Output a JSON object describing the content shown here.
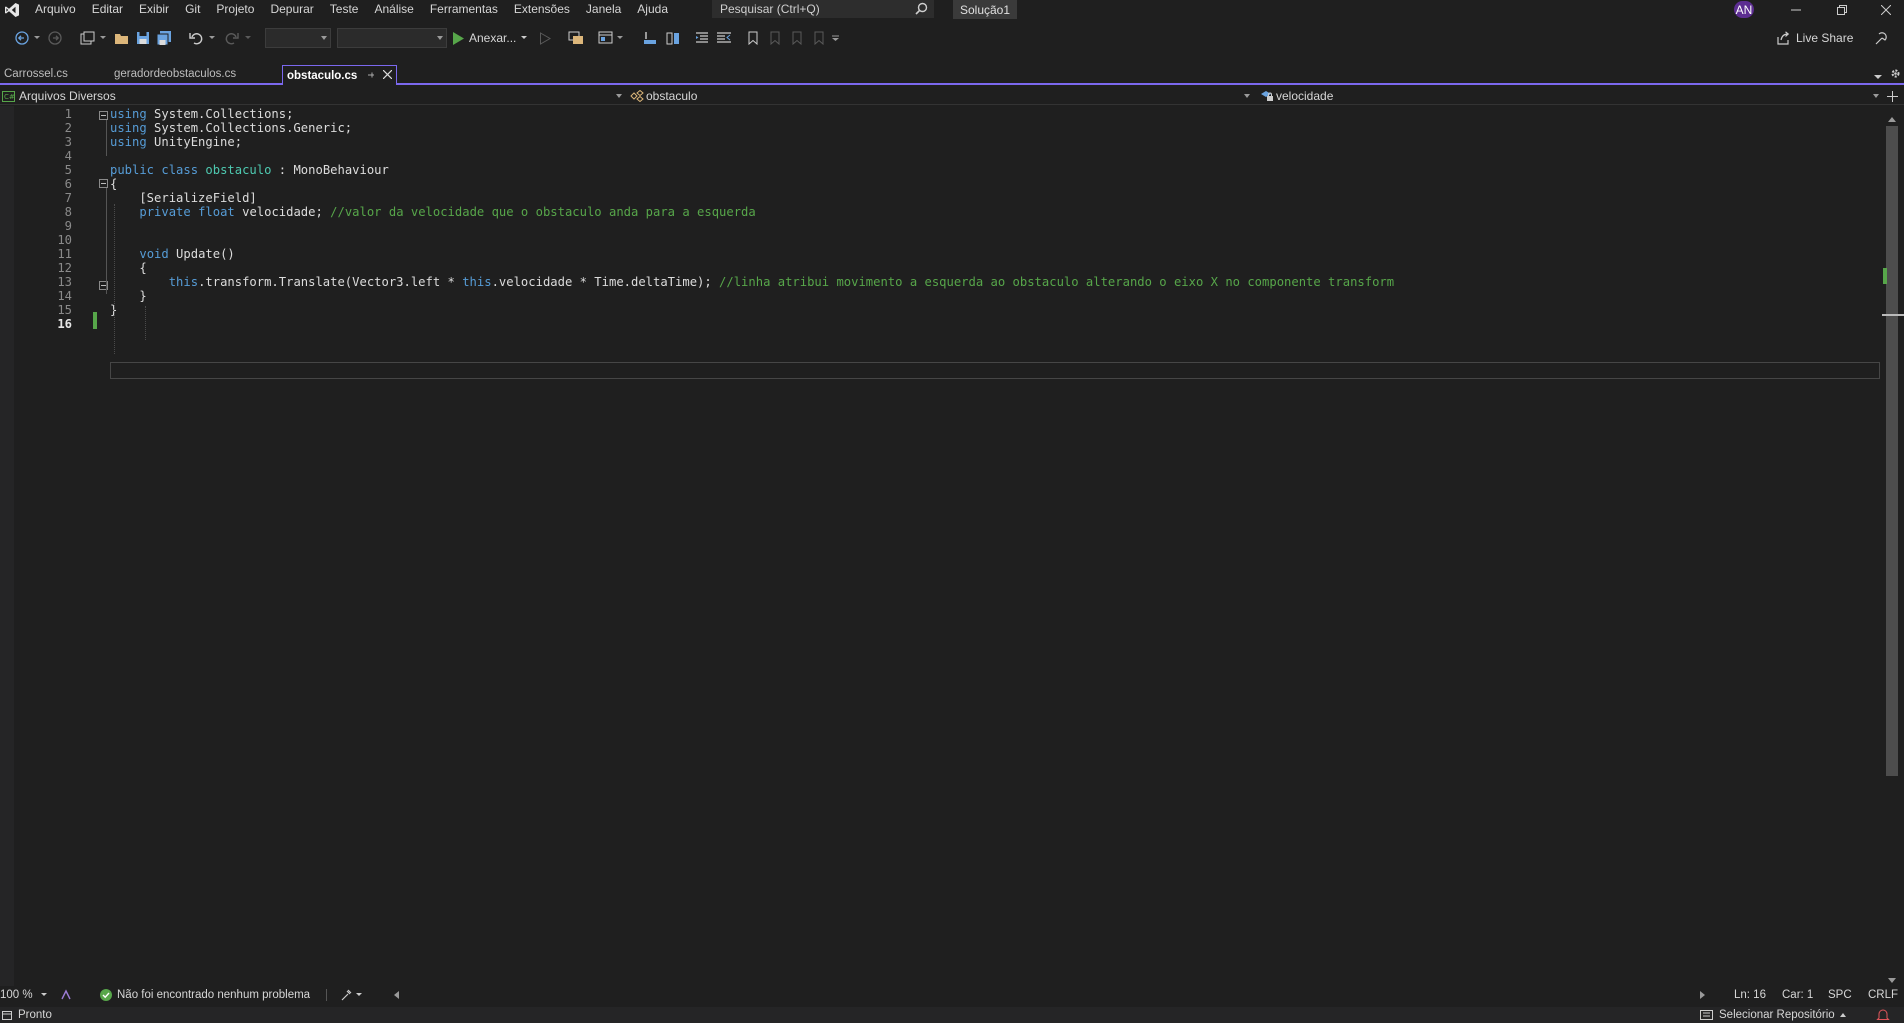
{
  "menubar": {
    "items": [
      "Arquivo",
      "Editar",
      "Exibir",
      "Git",
      "Projeto",
      "Depurar",
      "Teste",
      "Análise",
      "Ferramentas",
      "Extensões",
      "Janela",
      "Ajuda"
    ],
    "search_placeholder": "Pesquisar (Ctrl+Q)",
    "solution_name": "Solução1",
    "user_initials": "AN"
  },
  "toolbar": {
    "attach_label": "Anexar...",
    "live_share_label": "Live Share"
  },
  "tabs": [
    {
      "label": "Carrossel.cs"
    },
    {
      "label": "geradordeobstaculos.cs"
    },
    {
      "label": "obstaculo.cs"
    }
  ],
  "navbar": {
    "project": "Arquivos Diversos",
    "class": "obstaculo",
    "member": "velocidade"
  },
  "editor": {
    "line_numbers": [
      "1",
      "2",
      "3",
      "4",
      "5",
      "6",
      "7",
      "8",
      "9",
      "10",
      "11",
      "12",
      "13",
      "14",
      "15",
      "16"
    ],
    "lines": [
      [
        {
          "t": "using",
          "c": "kw"
        },
        {
          "t": " System.Collections;",
          "c": ""
        }
      ],
      [
        {
          "t": "using",
          "c": "kw"
        },
        {
          "t": " System.Collections.Generic;",
          "c": ""
        }
      ],
      [
        {
          "t": "using",
          "c": "kw"
        },
        {
          "t": " UnityEngine;",
          "c": ""
        }
      ],
      [],
      [
        {
          "t": "public",
          "c": "kw"
        },
        {
          "t": " ",
          "c": ""
        },
        {
          "t": "class",
          "c": "kw"
        },
        {
          "t": " ",
          "c": ""
        },
        {
          "t": "obstaculo",
          "c": "ty"
        },
        {
          "t": " : MonoBehaviour",
          "c": ""
        }
      ],
      [
        {
          "t": "{",
          "c": ""
        }
      ],
      [
        {
          "t": "    [SerializeField]",
          "c": ""
        }
      ],
      [
        {
          "t": "    ",
          "c": ""
        },
        {
          "t": "private",
          "c": "kw"
        },
        {
          "t": " ",
          "c": ""
        },
        {
          "t": "float",
          "c": "kw"
        },
        {
          "t": " velocidade; ",
          "c": ""
        },
        {
          "t": "//valor da velocidade que o obstaculo anda para a esquerda",
          "c": "cm"
        }
      ],
      [],
      [],
      [
        {
          "t": "    ",
          "c": ""
        },
        {
          "t": "void",
          "c": "kw"
        },
        {
          "t": " Update()",
          "c": ""
        }
      ],
      [
        {
          "t": "    {",
          "c": ""
        }
      ],
      [
        {
          "t": "        ",
          "c": ""
        },
        {
          "t": "this",
          "c": "kw"
        },
        {
          "t": ".transform.Translate(Vector3.left * ",
          "c": ""
        },
        {
          "t": "this",
          "c": "kw"
        },
        {
          "t": ".velocidade * Time.deltaTime); ",
          "c": ""
        },
        {
          "t": "//linha atribui movimento a esquerda ao obstaculo alterando o eixo X no componente transform",
          "c": "cm"
        }
      ],
      [
        {
          "t": "    }",
          "c": ""
        }
      ],
      [
        {
          "t": "}",
          "c": ""
        }
      ],
      []
    ],
    "current_line": "16"
  },
  "editor_status": {
    "zoom": "100 %",
    "problems": "Não foi encontrado nenhum problema",
    "line": "Ln: 16",
    "col": "Car: 1",
    "spacing": "SPC",
    "line_ending": "CRLF"
  },
  "statusbar": {
    "ready": "Pronto",
    "repo": "Selecionar Repositório"
  }
}
